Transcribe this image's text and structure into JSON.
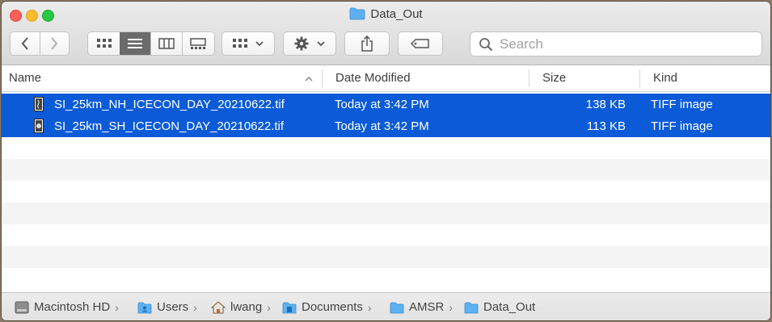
{
  "window": {
    "title": "Data_Out"
  },
  "search": {
    "placeholder": "Search"
  },
  "columns": {
    "name": "Name",
    "date": "Date Modified",
    "size": "Size",
    "kind": "Kind"
  },
  "files": [
    {
      "name": "SI_25km_NH_ICECON_DAY_20210622.tif",
      "date": "Today at 3:42 PM",
      "size": "138 KB",
      "kind": "TIFF image"
    },
    {
      "name": "SI_25km_SH_ICECON_DAY_20210622.tif",
      "date": "Today at 3:42 PM",
      "size": "113 KB",
      "kind": "TIFF image"
    }
  ],
  "path": [
    {
      "label": "Macintosh HD",
      "icon": "hard-drive-icon"
    },
    {
      "label": "Users",
      "icon": "users-folder-icon"
    },
    {
      "label": "lwang",
      "icon": "home-icon"
    },
    {
      "label": "Documents",
      "icon": "documents-folder-icon"
    },
    {
      "label": "AMSR",
      "icon": "folder-icon"
    },
    {
      "label": "Data_Out",
      "icon": "folder-icon"
    }
  ],
  "colors": {
    "selection": "#0b5bd8",
    "folder": "#5fb0f0"
  }
}
